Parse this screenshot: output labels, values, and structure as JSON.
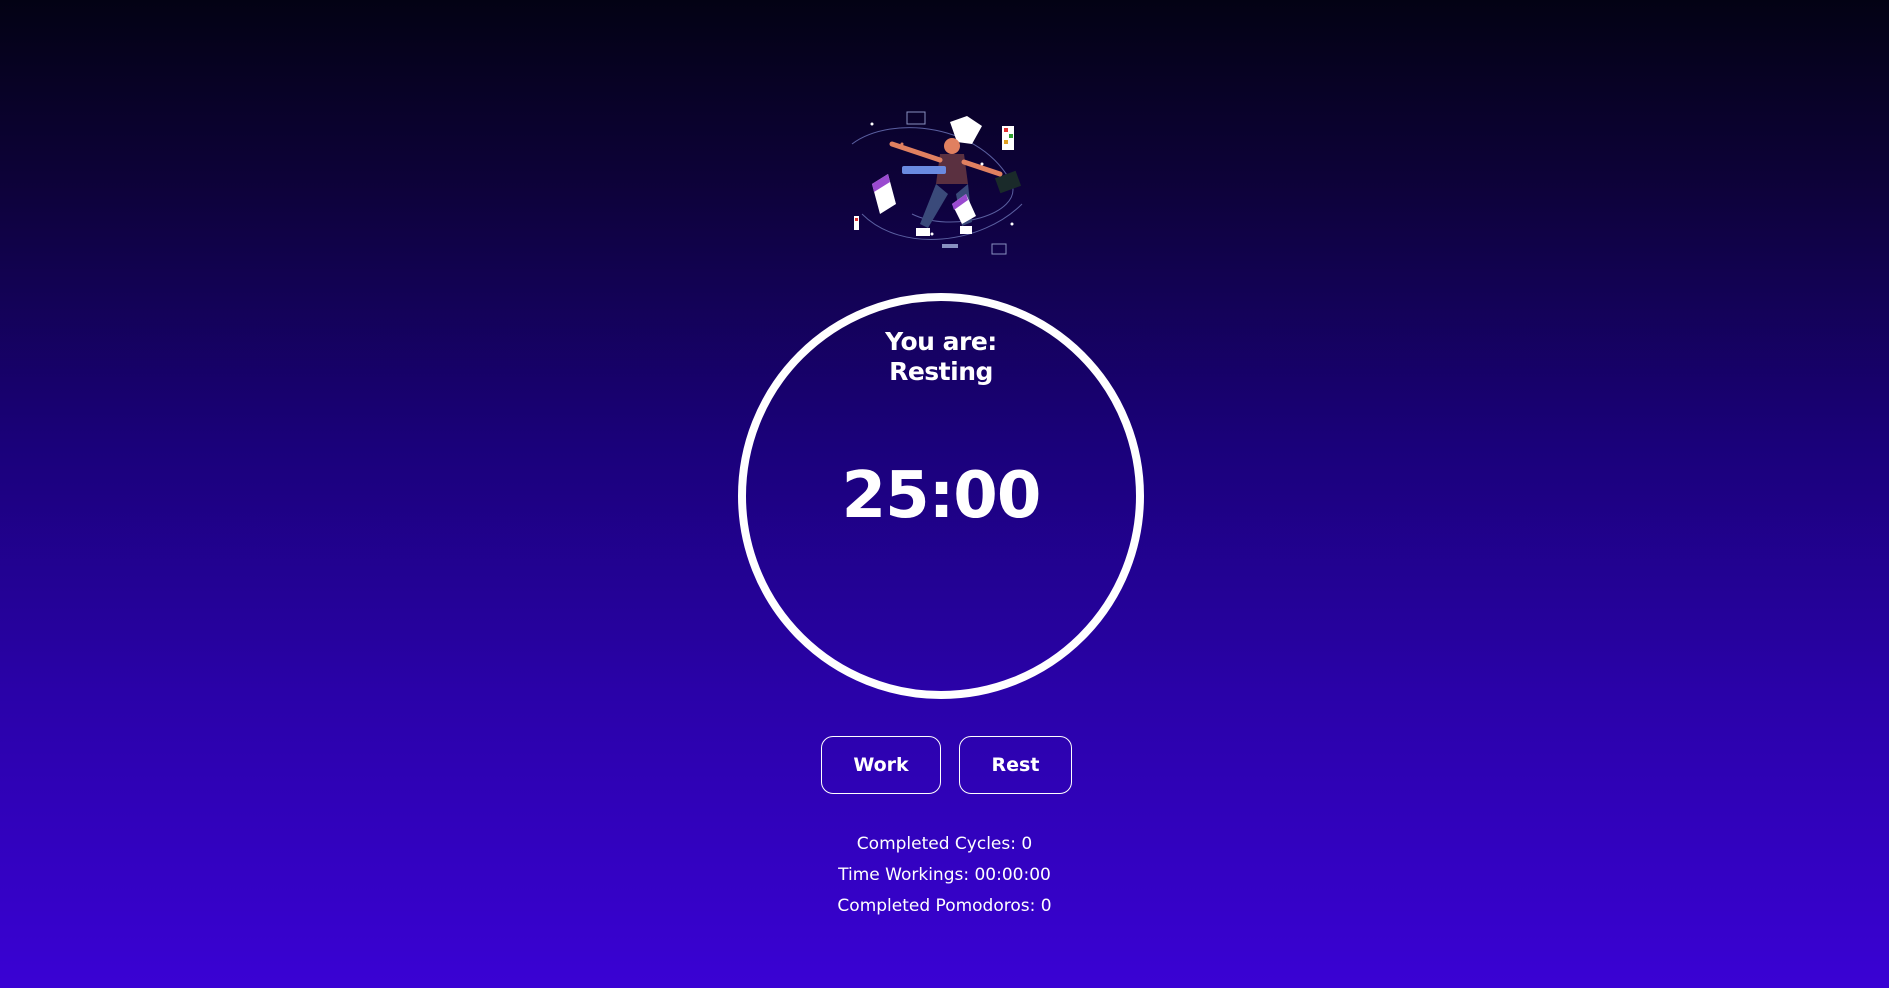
{
  "timer": {
    "status_prefix": "You are:",
    "status_value": "Resting",
    "time": "25:00"
  },
  "controls": {
    "work_label": "Work",
    "rest_label": "Rest"
  },
  "stats": {
    "completed_cycles": "Completed Cycles: 0",
    "time_working": "Time Workings: 00:00:00",
    "completed_pomodoros": "Completed Pomodoros: 0"
  },
  "illustration": {
    "icon": "floating-developer-illustration"
  },
  "colors": {
    "background_top": "#030214",
    "background_bottom": "#3a02d4",
    "foreground": "#ffffff"
  }
}
